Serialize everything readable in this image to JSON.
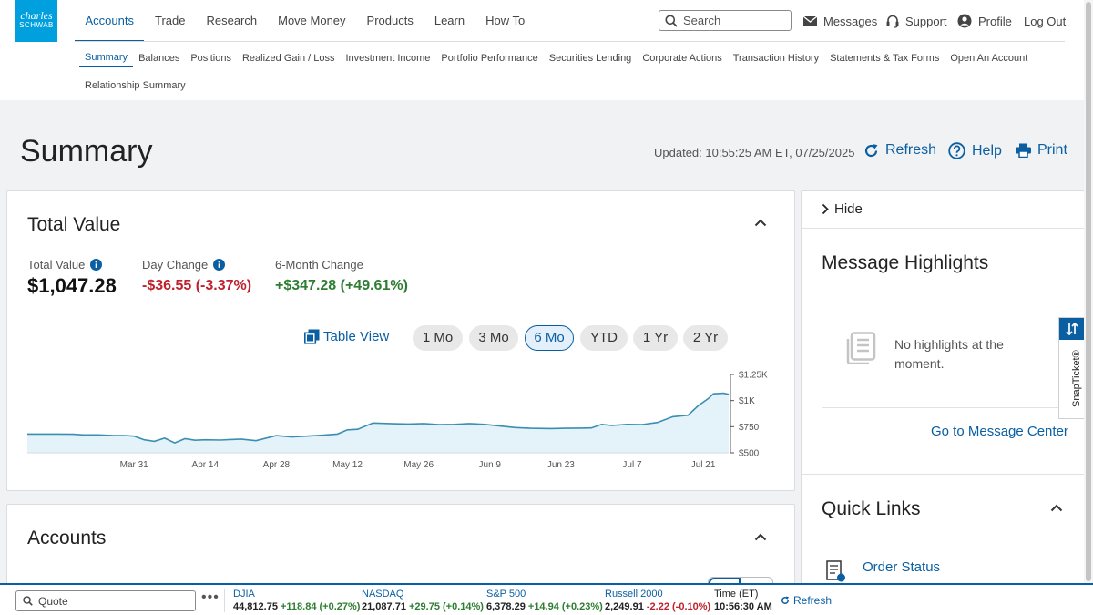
{
  "logo": {
    "line1": "charles",
    "line2": "SCHWAB"
  },
  "nav": {
    "items": [
      "Accounts",
      "Trade",
      "Research",
      "Move Money",
      "Products",
      "Learn",
      "How To"
    ],
    "active": "Accounts"
  },
  "search": {
    "placeholder": "Search",
    "icon": "search-icon"
  },
  "utility": {
    "messages": "Messages",
    "support": "Support",
    "profile": "Profile",
    "logout": "Log Out"
  },
  "subnav": {
    "items": [
      "Summary",
      "Balances",
      "Positions",
      "Realized Gain / Loss",
      "Investment Income",
      "Portfolio Performance",
      "Securities Lending",
      "Corporate Actions",
      "Transaction History",
      "Statements & Tax Forms",
      "Open An Account",
      "Relationship Summary"
    ],
    "active": "Summary"
  },
  "page": {
    "title": "Summary",
    "updated": "Updated: 10:55:25 AM ET, 07/25/2025",
    "refresh": "Refresh",
    "help": "Help",
    "print": "Print"
  },
  "total_value_card": {
    "title": "Total Value",
    "total_value_label": "Total Value",
    "total_value": "$1,047.28",
    "day_change_label": "Day Change",
    "day_change": "-$36.55 (-3.37%)",
    "six_month_label": "6-Month Change",
    "six_month_change": "+$347.28 (+49.61%)",
    "table_view": "Table View",
    "ranges": [
      "1 Mo",
      "3 Mo",
      "6 Mo",
      "YTD",
      "1 Yr",
      "2 Yr"
    ],
    "active_range": "6 Mo"
  },
  "chart_data": {
    "type": "area",
    "x_tick_labels": [
      "Mar 31",
      "Apr 14",
      "Apr 28",
      "May 12",
      "May 26",
      "Jun 9",
      "Jun 23",
      "Jul 7",
      "Jul 21"
    ],
    "y_tick_labels": [
      "$1.25K",
      "$1K",
      "$750",
      "$500"
    ],
    "ylim": [
      500,
      1250
    ],
    "y_ticks": [
      1250,
      1000,
      750,
      500
    ],
    "x_tick_days": [
      21,
      35,
      49,
      63,
      77,
      91,
      105,
      119,
      133
    ],
    "series": [
      {
        "days": [
          0,
          3,
          6,
          9,
          11,
          14,
          17,
          19,
          21,
          23,
          25,
          27,
          29,
          31,
          33,
          35,
          38,
          42,
          45,
          49,
          52,
          55,
          58,
          61,
          63,
          65,
          68,
          72,
          75,
          78,
          81,
          84,
          87,
          90,
          93,
          96,
          99,
          103,
          106,
          109,
          111,
          113,
          115,
          118,
          121,
          124,
          127,
          130,
          132,
          134,
          135,
          137,
          138
        ],
        "values": [
          680,
          680,
          680,
          678,
          672,
          672,
          665,
          666,
          660,
          625,
          610,
          640,
          595,
          635,
          620,
          625,
          622,
          632,
          616,
          665,
          652,
          660,
          668,
          680,
          720,
          725,
          785,
          778,
          776,
          780,
          770,
          772,
          780,
          772,
          756,
          742,
          735,
          732,
          735,
          736,
          738,
          772,
          762,
          772,
          770,
          790,
          845,
          860,
          950,
          1020,
          1065,
          1070,
          1060
        ]
      }
    ],
    "grid": false,
    "legend": "none"
  },
  "accounts_card": {
    "title": "Accounts"
  },
  "side_panel": {
    "hide": "Hide",
    "message_highlights_title": "Message Highlights",
    "no_highlights": "No highlights at the moment.",
    "message_center_link": "Go to Message Center",
    "quick_links_title": "Quick Links",
    "order_status": "Order Status"
  },
  "snapticket": {
    "label": "SnapTicket®"
  },
  "ticker": {
    "quote_placeholder": "Quote",
    "indices": [
      {
        "name": "DJIA",
        "value": "44,812.75",
        "change": "+118.84 (+0.27%)",
        "direction": "up"
      },
      {
        "name": "NASDAQ",
        "value": "21,087.71",
        "change": "+29.75 (+0.14%)",
        "direction": "up"
      },
      {
        "name": "S&P 500",
        "value": "6,378.29",
        "change": "+14.94 (+0.23%)",
        "direction": "up"
      },
      {
        "name": "Russell 2000",
        "value": "2,249.91",
        "change": "-2.22 (-0.10%)",
        "direction": "down"
      }
    ],
    "time_label": "Time (ET)",
    "time_value": "10:56:30 AM",
    "refresh": "Refresh"
  },
  "colors": {
    "brand": "#00a0df",
    "link": "#0a5fa3",
    "negative": "#c0202c",
    "positive": "#2e7d32",
    "chart_line": "#3a8fb0",
    "chart_fill": "#e4f3fa"
  }
}
